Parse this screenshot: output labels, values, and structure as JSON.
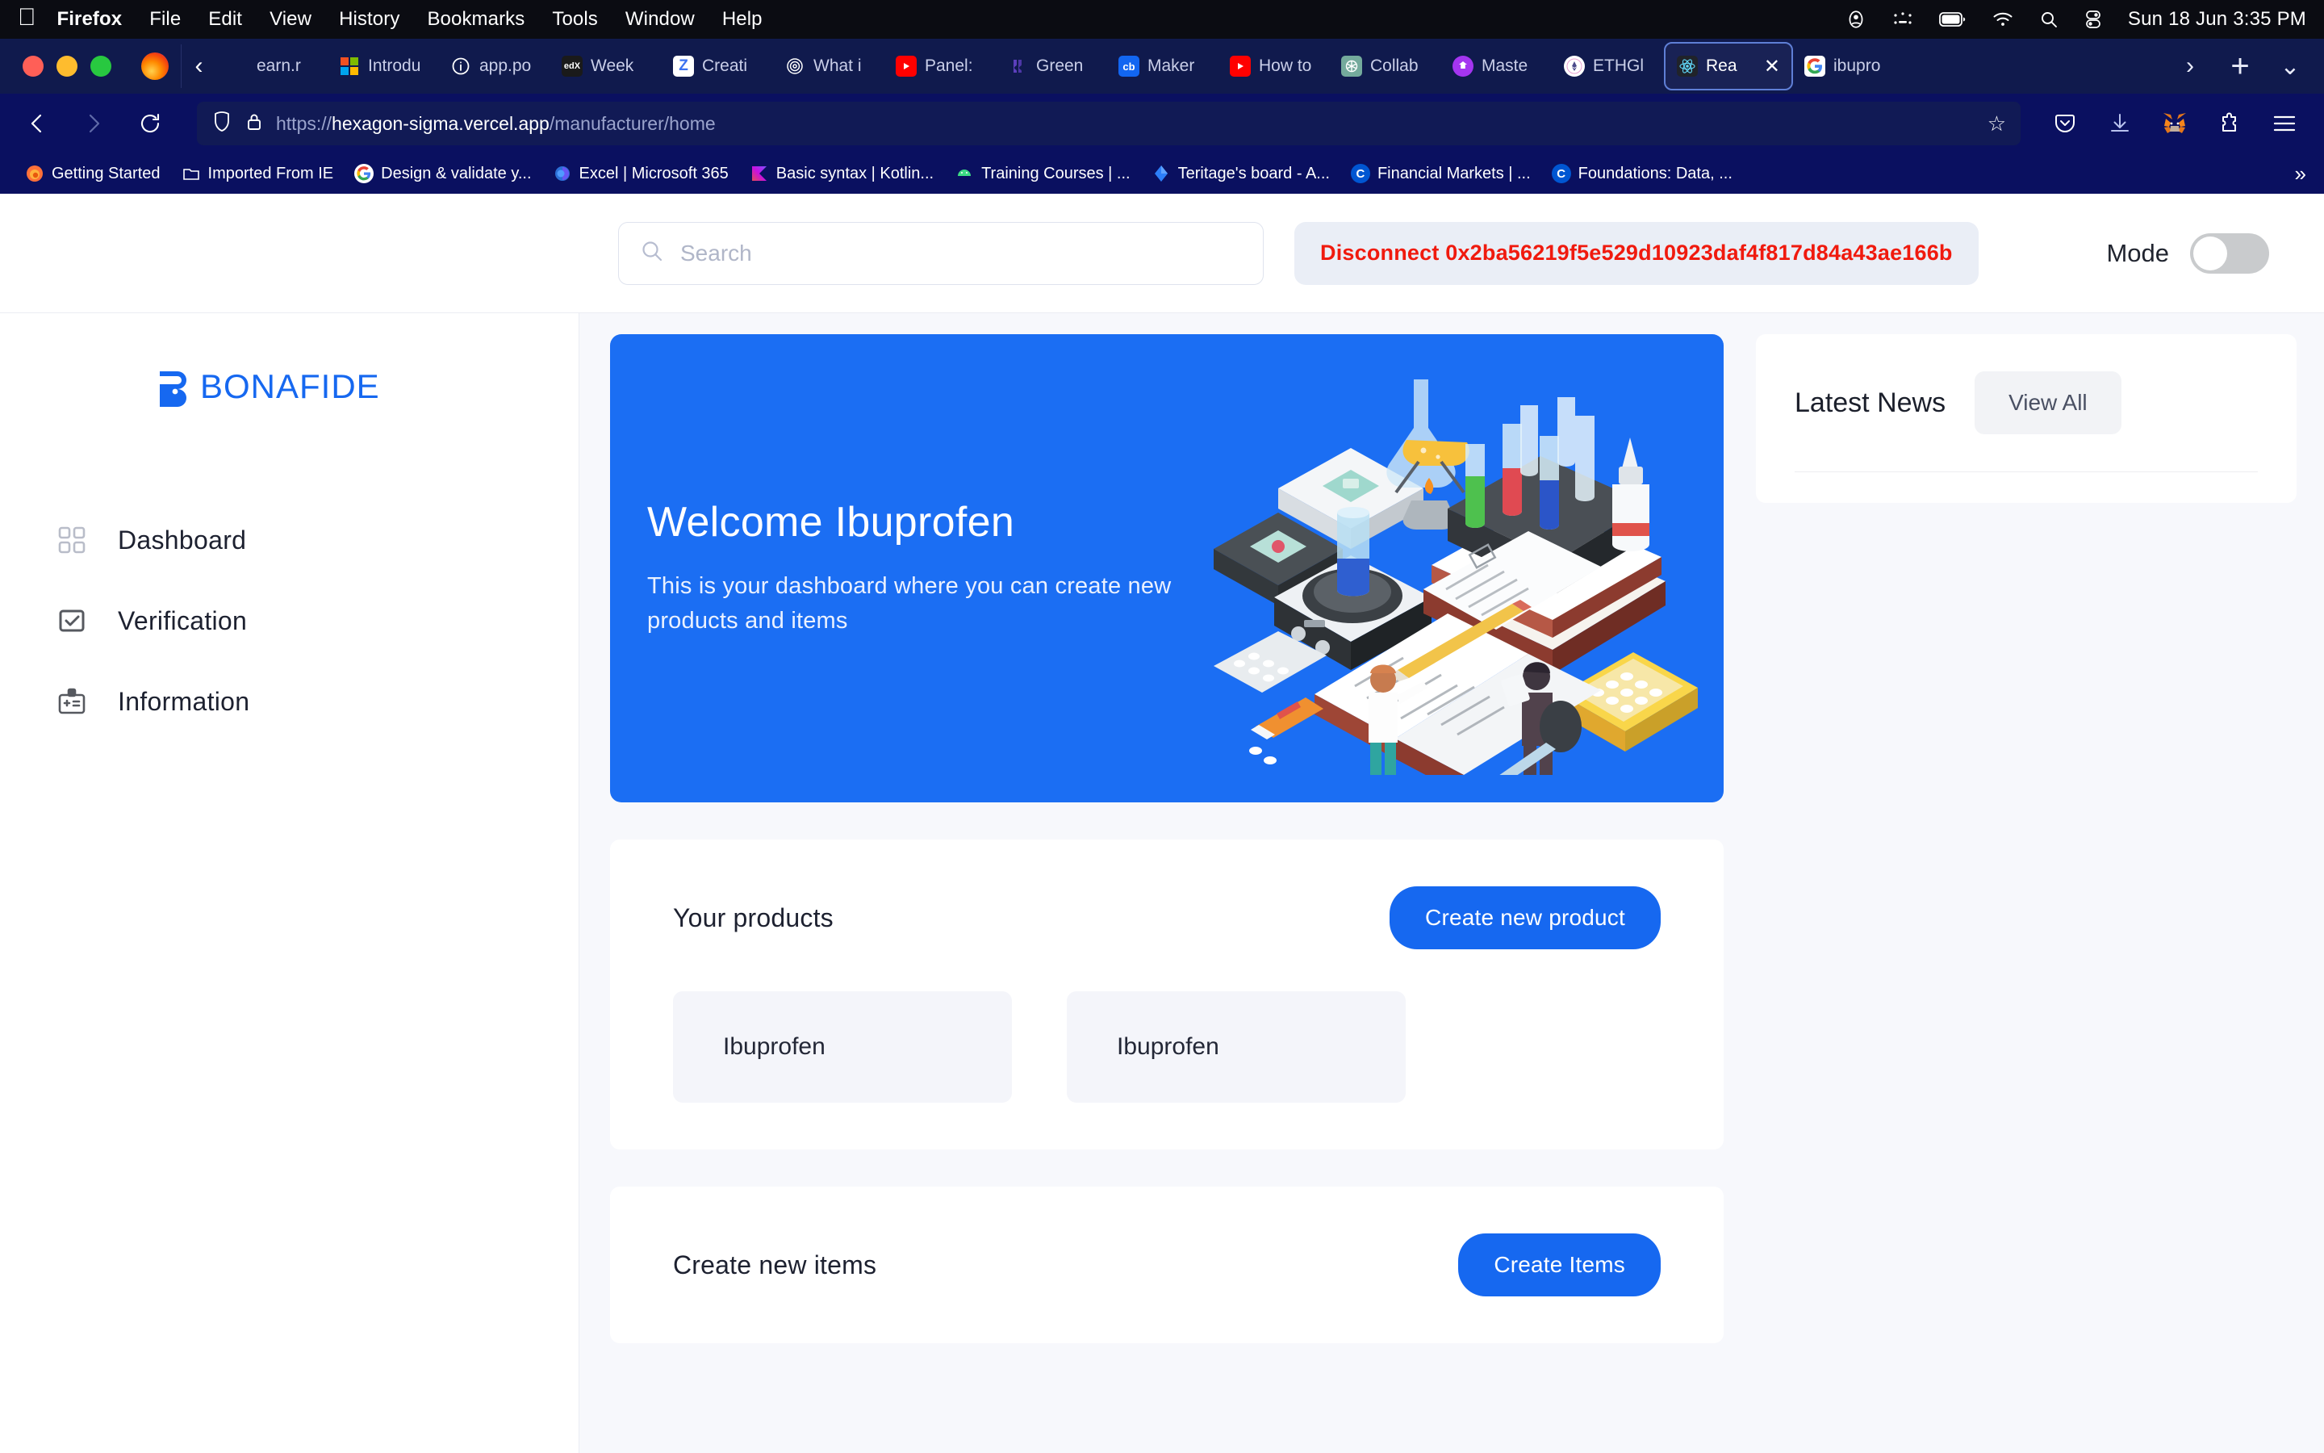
{
  "os_menubar": {
    "apple_icon": "apple-icon",
    "items": [
      "Firefox",
      "File",
      "Edit",
      "View",
      "History",
      "Bookmarks",
      "Tools",
      "Window",
      "Help"
    ],
    "status_icons": [
      "user-account-icon",
      "control-center-dots-icon",
      "battery-icon",
      "wifi-icon",
      "search-icon",
      "control-center-icon"
    ],
    "clock": "Sun 18 Jun  3:35 PM"
  },
  "browser": {
    "tabs": [
      {
        "label": "earn.r",
        "favicon": "",
        "favicon_bg": "transparent",
        "active": false
      },
      {
        "label": "Introdu",
        "favicon": "microsoft-icon",
        "favicon_bg": "#ffffff",
        "active": false
      },
      {
        "label": "app.po",
        "favicon": "info-icon",
        "favicon_bg": "transparent",
        "active": false
      },
      {
        "label": "Week",
        "favicon": "edx-icon",
        "favicon_bg": "#1a1a1a",
        "active": false
      },
      {
        "label": "Creati",
        "favicon": "Z",
        "favicon_bg": "#ffffff",
        "active": false
      },
      {
        "label": "What i",
        "favicon": "spiral-icon",
        "favicon_bg": "transparent",
        "active": false
      },
      {
        "label": "Panel:",
        "favicon": "youtube-icon",
        "favicon_bg": "#ff0000",
        "active": false
      },
      {
        "label": "Green",
        "favicon": "gitlab-icon",
        "favicon_bg": "transparent",
        "active": false
      },
      {
        "label": "Maker",
        "favicon": "cb",
        "favicon_bg": "#1266f1",
        "active": false
      },
      {
        "label": "How to",
        "favicon": "youtube-icon",
        "favicon_bg": "#ff0000",
        "active": false
      },
      {
        "label": "Collab",
        "favicon": "openai-icon",
        "favicon_bg": "#74aa9c",
        "active": false
      },
      {
        "label": "Maste",
        "favicon": "udemy-icon",
        "favicon_bg": "#a435f0",
        "active": false
      },
      {
        "label": "ETHGl",
        "favicon": "ethglobal-icon",
        "favicon_bg": "#ffffff",
        "active": false
      },
      {
        "label": "Rea",
        "favicon": "react-icon",
        "favicon_bg": "#20232a",
        "active": true
      },
      {
        "label": "ibupro",
        "favicon": "google-icon",
        "favicon_bg": "#ffffff",
        "active": false
      }
    ],
    "tab_close_label": "✕",
    "tab_scroll_left": "‹",
    "tab_scroll_right": "›",
    "new_tab_label": "+",
    "list_all_tabs_label": "⌄",
    "nav": {
      "back_icon": "back-arrow-icon",
      "forward_icon": "forward-arrow-icon",
      "reload_icon": "reload-icon",
      "shield_icon": "shield-icon",
      "lock_icon": "lock-icon",
      "url_scheme": "https://",
      "url_host": "hexagon-sigma.vercel.app",
      "url_path": "/manufacturer/home",
      "bookmark_star": "☆"
    },
    "toolbar_right_icons": [
      "pocket-icon",
      "downloads-icon",
      "metamask-icon",
      "extensions-icon",
      "menu-icon"
    ],
    "bookmarks": [
      {
        "label": "Getting Started",
        "icon": "firefox-icon",
        "bg": "transparent"
      },
      {
        "label": "Imported From IE",
        "icon": "folder-icon",
        "bg": "transparent"
      },
      {
        "label": "Design & validate y...",
        "icon": "google-icon",
        "bg": "#ffffff"
      },
      {
        "label": "Excel | Microsoft 365",
        "icon": "excel-icon",
        "bg": "transparent"
      },
      {
        "label": "Basic syntax | Kotlin...",
        "icon": "kotlin-icon",
        "bg": "transparent"
      },
      {
        "label": "Training Courses  |  ...",
        "icon": "android-icon",
        "bg": "transparent"
      },
      {
        "label": "Teritage's board - A...",
        "icon": "diamond-icon",
        "bg": "transparent"
      },
      {
        "label": "Financial Markets | ...",
        "icon": "coursera-icon",
        "bg": "#0056d2"
      },
      {
        "label": "Foundations: Data, ...",
        "icon": "coursera-icon",
        "bg": "#0056d2"
      }
    ],
    "bookmarks_overflow": "»"
  },
  "app": {
    "brand": {
      "name": "BONAFIDE",
      "accent_color": "#1668f0"
    },
    "sidebar": {
      "items": [
        {
          "label": "Dashboard",
          "icon": "grid-icon",
          "active": true
        },
        {
          "label": "Verification",
          "icon": "checkbox-icon",
          "active": false
        },
        {
          "label": "Information",
          "icon": "id-badge-icon",
          "active": false
        }
      ]
    },
    "topbar": {
      "search": {
        "placeholder": "Search",
        "value": "",
        "icon": "search-icon"
      },
      "wallet": {
        "action": "Disconnect",
        "address": "0x2ba56219f5e529d10923daf4f817d84a43ae166b",
        "full_label": "Disconnect 0x2ba56219f5e529d10923daf4f817d84a43ae166b",
        "text_color": "#f01a0e",
        "bg_color": "#eaeef6"
      },
      "mode": {
        "label": "Mode",
        "enabled": false
      }
    },
    "banner": {
      "title": "Welcome Ibuprofen",
      "subtitle": "This is your dashboard where you can create new products and items",
      "bg_color": "#1b6ef3",
      "illustration": "pharmaceutical-lab-illustration"
    },
    "products_section": {
      "title": "Your products",
      "create_button": "Create new product",
      "products": [
        {
          "name": "Ibuprofen"
        },
        {
          "name": "Ibuprofen"
        }
      ]
    },
    "items_section": {
      "title": "Create new items",
      "create_button": "Create Items"
    },
    "news_card": {
      "title": "Latest News",
      "view_all_button": "View All"
    }
  }
}
